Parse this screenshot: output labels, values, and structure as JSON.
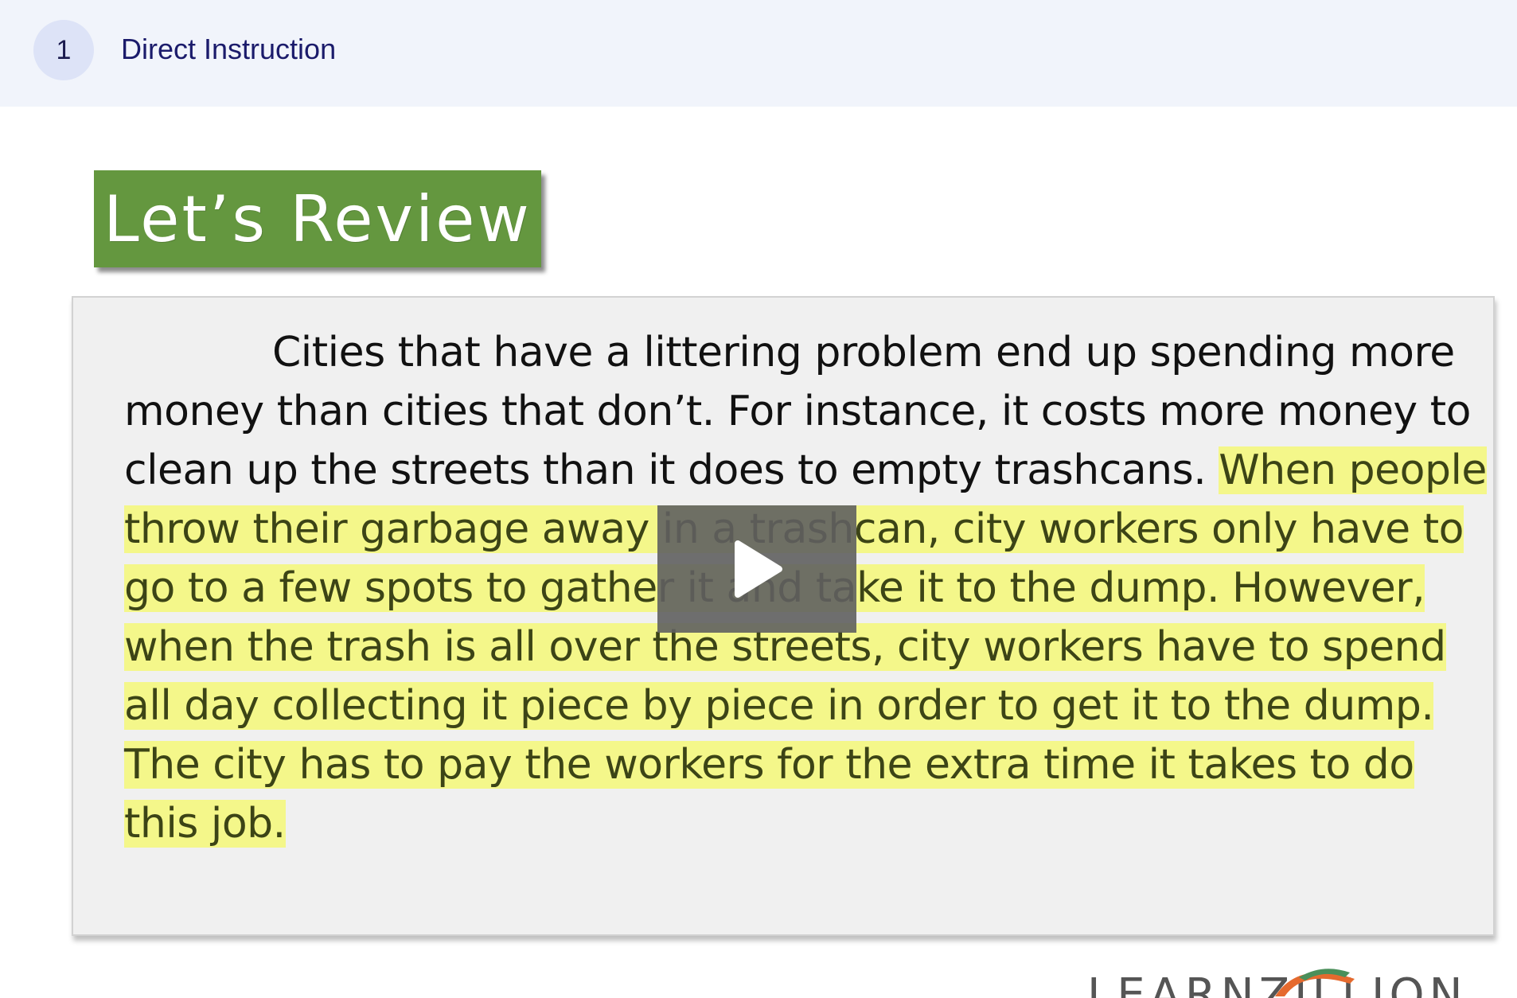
{
  "header": {
    "step_number": "1",
    "step_title": "Direct Instruction"
  },
  "video": {
    "banner_title": "Let’s Review",
    "passage": {
      "plain": "Cities that have a littering problem end up spending more money than cities that don’t. For instance, it costs more money to clean up the streets than it does to empty trashcans. ",
      "highlighted": "When people throw their garbage away in a trashcan, city workers only have to go to a few spots to gather it and take it to the dump. However, when the trash is all over the streets, city workers have to spend all day collecting it piece by piece in order to get it to the dump. The city has to pay the workers for the extra time it takes to do this job."
    },
    "highlight_color": "#f4f78a",
    "banner_color": "#64973f",
    "play_icon": "play-icon",
    "logo_text": "LEARNZILLION"
  }
}
